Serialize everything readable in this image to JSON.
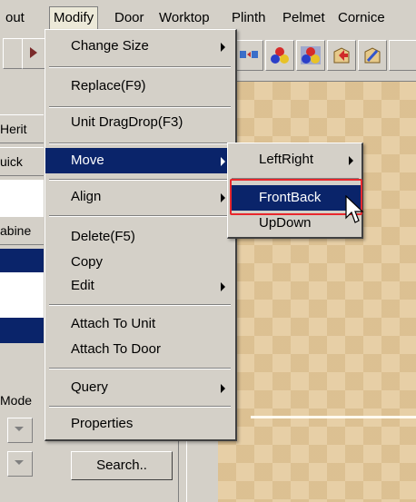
{
  "menubar": {
    "items": [
      "out",
      "Modify",
      "Door",
      "Worktop",
      "Plinth",
      "Pelmet",
      "Cornice"
    ],
    "active_index": 1
  },
  "left_panel": {
    "labels": [
      "Herit",
      "uick",
      "abine",
      "Mode"
    ]
  },
  "search": {
    "label": "Search.."
  },
  "modify_menu": {
    "items": [
      {
        "label": "Change Size",
        "submenu": true
      },
      {
        "label": "Replace(F9)",
        "submenu": false
      },
      {
        "label": "Unit DragDrop(F3)",
        "submenu": false
      },
      {
        "label": "Move",
        "submenu": true,
        "highlighted": true
      },
      {
        "label": "Align",
        "submenu": true
      },
      {
        "label": "Delete(F5)",
        "submenu": false
      },
      {
        "label": "Copy",
        "submenu": false
      },
      {
        "label": "Edit",
        "submenu": true
      },
      {
        "label": "Attach To Unit",
        "submenu": false
      },
      {
        "label": "Attach To Door",
        "submenu": false
      },
      {
        "label": "Query",
        "submenu": true
      },
      {
        "label": "Properties",
        "submenu": false
      }
    ]
  },
  "move_submenu": {
    "items": [
      {
        "label": "LeftRight",
        "submenu": true
      },
      {
        "label": "FrontBack",
        "submenu": false,
        "highlighted": true
      },
      {
        "label": "UpDown",
        "submenu": false
      }
    ]
  },
  "toolbar": {
    "icons": [
      "swap-icon",
      "colors-icon",
      "paint-colors-icon",
      "cabinet-arrow-icon",
      "edit-cabinet-icon"
    ]
  },
  "colors": {
    "menu_highlight": "#0a246a",
    "annotation_box": "#e8282d",
    "canvas_floor": "#e7cfa6"
  }
}
